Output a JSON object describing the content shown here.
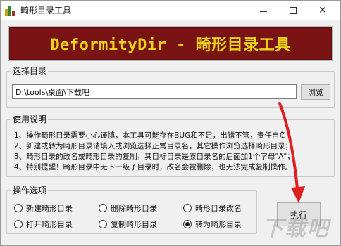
{
  "window": {
    "title": "畸形目录工具",
    "icons": {
      "app": "app-icon",
      "minimize": "minimize-icon",
      "maximize": "maximize-icon",
      "close": "close-icon"
    }
  },
  "banner": {
    "text": "DeformityDir - 畸形目录工具"
  },
  "select_dir": {
    "label": "选择目录",
    "path_value": "D:\\tools\\桌面\\下载吧",
    "browse_label": "浏览"
  },
  "usage": {
    "label": "使用说明",
    "lines": [
      "1、操作畸形目录需要小心谨慎，本工具可能存在BUG和不足，出错不管，责任自负！",
      "2、新建或转为畸形目录请填入或浏览选择正常目录名，其它操作浏览选择畸形目录；",
      "3、畸形目录的改名或畸形目录的复制，其目标目录是原目录名的后面加1个字母\"A\"；",
      "4、特别提醒！畸形目录中无下一级子目录时，改名会被删除，也无法完成复制操作。"
    ]
  },
  "operations": {
    "label": "操作选项",
    "options": [
      {
        "label": "新建畸形目录",
        "checked": false
      },
      {
        "label": "删除畸形目录",
        "checked": false
      },
      {
        "label": "畸形目录改名",
        "checked": false
      },
      {
        "label": "打开畸形目录",
        "checked": false
      },
      {
        "label": "复制畸形目录",
        "checked": false
      },
      {
        "label": "转为畸形目录",
        "checked": true
      }
    ]
  },
  "execute": {
    "label": "执行"
  },
  "colors": {
    "banner_bg": "#7a1414",
    "banner_text": "#e8d21a",
    "arrow": "#e02020"
  }
}
